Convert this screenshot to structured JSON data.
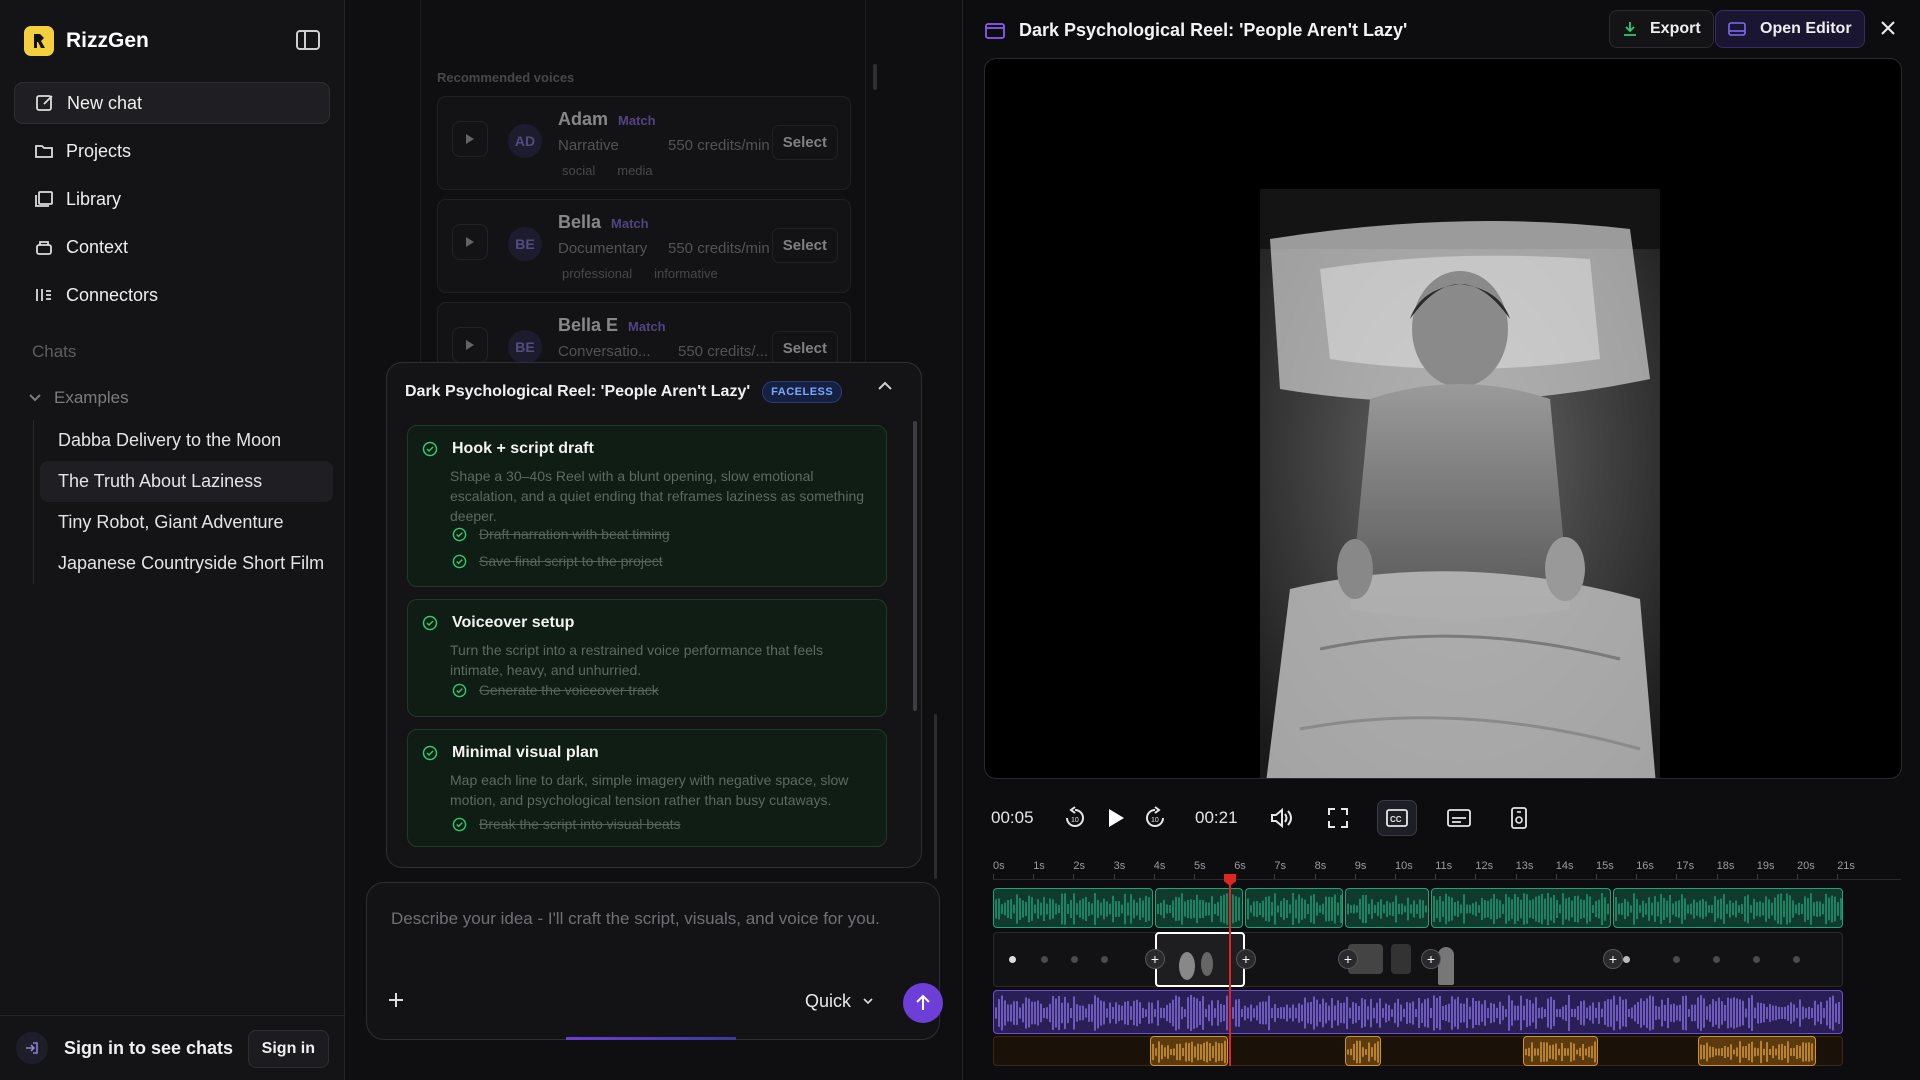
{
  "app": {
    "name": "RizzGen"
  },
  "sidebar": {
    "nav": [
      {
        "label": "New chat",
        "icon": "edit-icon"
      },
      {
        "label": "Projects",
        "icon": "folder-icon"
      },
      {
        "label": "Library",
        "icon": "library-icon"
      },
      {
        "label": "Context",
        "icon": "context-icon"
      },
      {
        "label": "Connectors",
        "icon": "connectors-icon"
      }
    ],
    "chats_label": "Chats",
    "examples_label": "Examples",
    "chats": [
      "Dabba Delivery to the Moon",
      "The Truth About Laziness",
      "Tiny Robot, Giant Adventure",
      "Japanese Countryside Short Film"
    ],
    "active_chat": 1,
    "footer": {
      "text": "Sign in to see chats",
      "button": "Sign in"
    }
  },
  "voices": {
    "label": "Recommended voices",
    "items": [
      {
        "initials": "AD",
        "name": "Adam",
        "match": "Match",
        "style": "Narrative",
        "credits": "550 credits/min",
        "tags": [
          "social",
          "media"
        ],
        "select": "Select"
      },
      {
        "initials": "BE",
        "name": "Bella",
        "match": "Match",
        "style": "Documentary",
        "credits": "550 credits/min",
        "tags": [
          "professional",
          "informative"
        ],
        "select": "Select"
      },
      {
        "initials": "BE",
        "name": "Bella E",
        "match": "Match",
        "style": "Conversatio...",
        "credits": "550 credits/...",
        "tags": [],
        "select": "Select"
      }
    ]
  },
  "plan": {
    "title": "Dark Psychological Reel: 'People Aren't Lazy'",
    "badge": "FACELESS",
    "steps": [
      {
        "title": "Hook + script draft",
        "desc": "Shape a 30–40s Reel with a blunt opening, slow emotional escalation, and a quiet ending that reframes laziness as something deeper.",
        "subs": [
          "Draft narration with beat timing",
          "Save final script to the project"
        ]
      },
      {
        "title": "Voiceover setup",
        "desc": "Turn the script into a restrained voice performance that feels intimate, heavy, and unhurried.",
        "subs": [
          "Generate the voiceover track"
        ]
      },
      {
        "title": "Minimal visual plan",
        "desc": "Map each line to dark, simple imagery with negative space, slow motion, and psychological tension rather than busy cutaways.",
        "subs": [
          "Break the script into visual beats"
        ]
      }
    ]
  },
  "composer": {
    "placeholder": "Describe your idea - I'll craft the script, visuals, and voice for you.",
    "mode": "Quick"
  },
  "preview": {
    "title": "Dark Psychological Reel: 'People Aren't Lazy'",
    "export": "Export",
    "open_editor": "Open Editor",
    "current_time": "00:05",
    "duration": "00:21",
    "ticks": [
      "0s",
      "1s",
      "2s",
      "3s",
      "4s",
      "5s",
      "6s",
      "7s",
      "8s",
      "9s",
      "10s",
      "11s",
      "12s",
      "13s",
      "14s",
      "15s",
      "16s",
      "17s",
      "18s",
      "19s",
      "20s",
      "21s"
    ]
  },
  "colors": {
    "accent": "#6d3fd8",
    "track_voice": "#1fa37a",
    "track_music": "#6b4fd0",
    "track_sfx": "#d4902a",
    "playhead": "#e02424"
  }
}
